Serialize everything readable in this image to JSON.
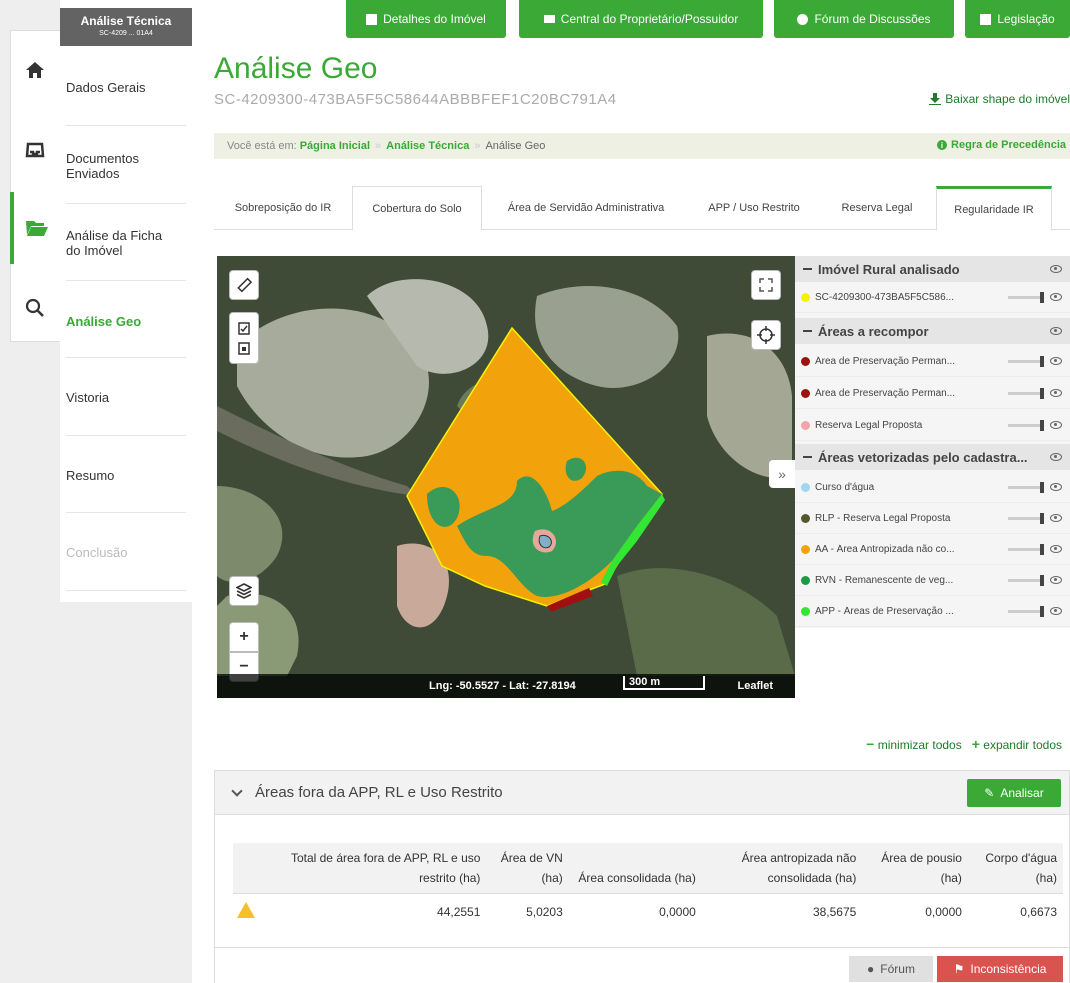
{
  "nav": {
    "header_title": "Análise Técnica",
    "header_sub": "SC-4209 ... 01A4",
    "items": [
      {
        "label": "Dados Gerais"
      },
      {
        "label": "Documentos Enviados"
      },
      {
        "label": "Análise da Ficha do Imóvel"
      },
      {
        "label": "Análise Geo"
      },
      {
        "label": "Vistoria"
      },
      {
        "label": "Resumo"
      },
      {
        "label": "Conclusão"
      }
    ]
  },
  "top_buttons": [
    {
      "label": "Detalhes do Imóvel",
      "icon": "list-icon"
    },
    {
      "label": "Central do Proprietário/Possuidor",
      "icon": "envelope-icon"
    },
    {
      "label": "Fórum de Discussões",
      "icon": "chat-icon"
    },
    {
      "label": "Legislação",
      "icon": "book-icon"
    }
  ],
  "header": {
    "title": "Análise Geo",
    "code": "SC-4209300-473BA5F5C58644ABBBFEF1C20BC791A4",
    "download": "Baixar shape do imóvel"
  },
  "breadcrumb": {
    "prefix": "Você está em:",
    "link1": "Página Inicial",
    "link2": "Análise Técnica",
    "current": "Análise Geo",
    "precedence": "Regra de Precedência"
  },
  "tabs": [
    {
      "label": "Sobreposição do IR"
    },
    {
      "label": "Cobertura do Solo"
    },
    {
      "label": "Área de Servidão Administrativa"
    },
    {
      "label": "APP / Uso Restrito"
    },
    {
      "label": "Reserva Legal"
    },
    {
      "label": "Regularidade IR"
    }
  ],
  "map": {
    "coords": "Lng: -50.5527 - Lat: -27.8194",
    "scale": "300 m",
    "attribution": "Leaflet",
    "zoom_in": "+",
    "zoom_out": "−",
    "collapse": "»"
  },
  "legend": {
    "groups": [
      {
        "title": "Imóvel Rural analisado"
      },
      {
        "title": "Áreas a recompor"
      },
      {
        "title": "Áreas vetorizadas pelo cadastra..."
      }
    ],
    "rows": [
      {
        "label": "SC-4209300-473BA5F5C586...",
        "color": "#f7f300"
      },
      {
        "label": "Área de Preservação Perman...",
        "color": "#a01010"
      },
      {
        "label": "Área de Preservação Perman...",
        "color": "#a01010"
      },
      {
        "label": "Reserva Legal Proposta",
        "color": "#f4a3a8"
      },
      {
        "label": "Curso d'água",
        "color": "#9fd6f0"
      },
      {
        "label": "RLP - Reserva Legal Proposta",
        "color": "#55582d"
      },
      {
        "label": "AA - Área Antropizada não co...",
        "color": "#f2a20a"
      },
      {
        "label": "RVN - Remanescente de veg...",
        "color": "#1e9a46"
      },
      {
        "label": "APP - Áreas de Preservação ...",
        "color": "#33e633"
      }
    ]
  },
  "toggles": {
    "minimize": "minimizar todos",
    "expand": "expandir todos"
  },
  "panel": {
    "title": "Áreas fora da APP, RL e Uso Restrito",
    "analyze": "Analisar",
    "columns": [
      "Total de área fora de APP, RL e uso restrito (ha)",
      "Área de VN (ha)",
      "Área consolidada (ha)",
      "Área antropizada não consolidada (ha)",
      "Área de pousio (ha)",
      "Corpo d'água (ha)"
    ],
    "values": [
      "44,2551",
      "5,0203",
      "0,0000",
      "38,5675",
      "0,0000",
      "0,6673"
    ],
    "forum": "Fórum",
    "inconsistency": "Inconsistência"
  }
}
